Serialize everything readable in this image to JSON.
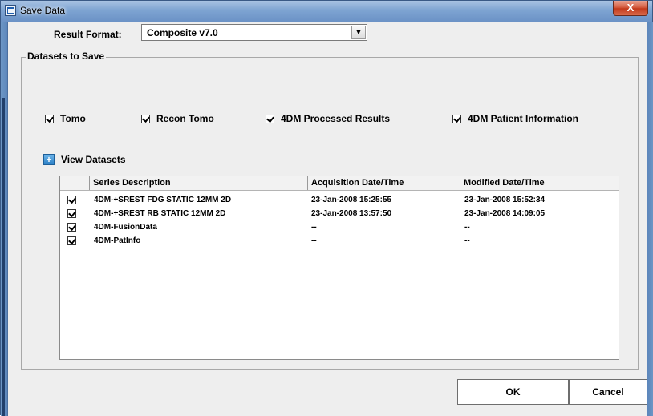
{
  "window": {
    "title": "Save Data",
    "close_label": "X"
  },
  "result_format": {
    "label": "Result Format:",
    "selected": "Composite v7.0"
  },
  "datasets_group": {
    "title": "Datasets to Save",
    "options": [
      {
        "label": "Tomo",
        "checked": true
      },
      {
        "label": "Recon Tomo",
        "checked": true
      },
      {
        "label": "4DM Processed Results",
        "checked": true
      },
      {
        "label": "4DM Patient Information",
        "checked": true
      }
    ]
  },
  "view_datasets": {
    "label": "View Datasets",
    "icon": "plus-icon"
  },
  "table": {
    "columns": [
      "Series Description",
      "Acquisition Date/Time",
      "Modified Date/Time"
    ],
    "rows": [
      {
        "checked": true,
        "description": "4DM-+SREST FDG STATIC 12MM 2D",
        "acquisition": "23-Jan-2008 15:25:55",
        "modified": "23-Jan-2008 15:52:34"
      },
      {
        "checked": true,
        "description": "4DM-+SREST RB STATIC 12MM 2D",
        "acquisition": "23-Jan-2008 13:57:50",
        "modified": "23-Jan-2008 14:09:05"
      },
      {
        "checked": true,
        "description": "4DM-FusionData",
        "acquisition": "--",
        "modified": "--"
      },
      {
        "checked": true,
        "description": "4DM-PatInfo",
        "acquisition": "--",
        "modified": "--"
      }
    ]
  },
  "buttons": {
    "ok": "OK",
    "cancel": "Cancel"
  }
}
